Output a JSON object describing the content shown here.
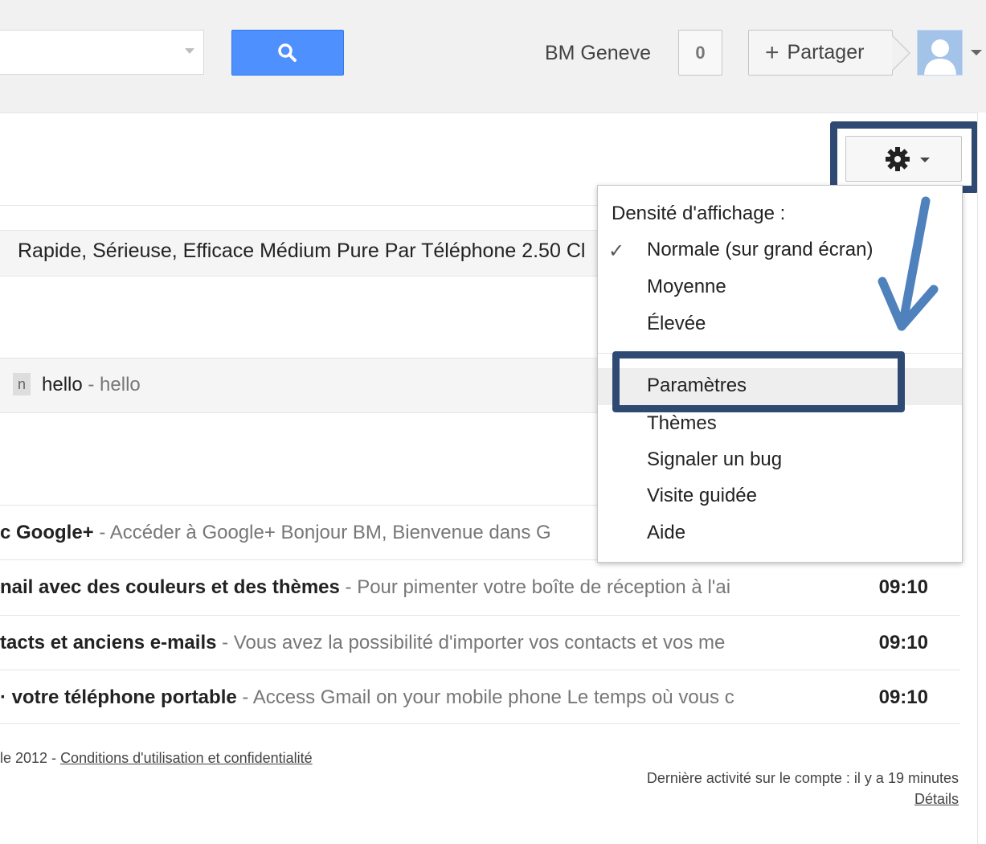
{
  "header": {
    "user_name": "BM Geneve",
    "notification_count": "0",
    "share_label": "Partager",
    "share_plus": "+"
  },
  "toolbar": {
    "settings_icon": "gear-icon"
  },
  "ad_row": {
    "text": "Rapide, Sérieuse, Efficace Médium Pure Par Téléphone 2.50 Cl"
  },
  "hello_row": {
    "label_chip": "n",
    "subject": "hello",
    "separator": " - ",
    "snippet": "hello"
  },
  "mails": [
    {
      "subject": "c Google+",
      "snippet": "Accéder à Google+ Bonjour BM, Bienvenue dans G",
      "time": ""
    },
    {
      "subject": "nail avec des couleurs et des thèmes",
      "snippet": "Pour pimenter votre boîte de réception à l'ai",
      "time": "09:10"
    },
    {
      "subject": "tacts et anciens e-mails",
      "snippet": "Vous avez la possibilité d'importer vos contacts et vos me",
      "time": "09:10"
    },
    {
      "subject": "· votre téléphone portable",
      "snippet": "Access Gmail on your mobile phone Le temps où vous c",
      "time": "09:10"
    }
  ],
  "footer": {
    "copyright": "le 2012 - ",
    "terms_link": "Conditions d'utilisation et confidentialité",
    "last_activity": "Dernière activité sur le compte : il y a 19 minutes",
    "details_link": "Détails"
  },
  "settings_menu": {
    "density_title": "Densité d'affichage :",
    "check_mark": "✓",
    "density_options": [
      "Normale (sur grand écran)",
      "Moyenne",
      "Élevée"
    ],
    "items": [
      "Paramètres",
      "Thèmes",
      "Signaler un bug",
      "Visite guidée",
      "Aide"
    ]
  },
  "annotation": {
    "highlight_color": "#2f4a72",
    "arrow_color": "#4f81bd"
  }
}
